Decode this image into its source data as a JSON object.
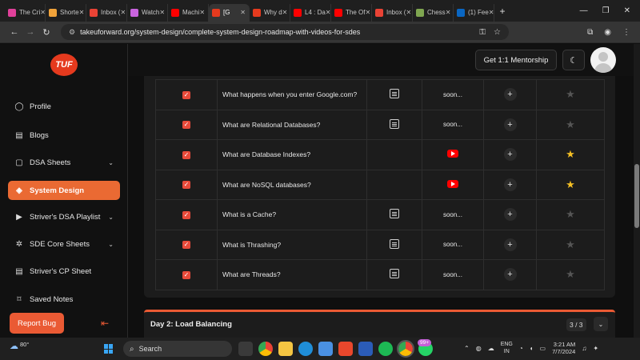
{
  "browser": {
    "tabs": [
      {
        "label": "The Cri",
        "color": "#e0409a"
      },
      {
        "label": "Shorte",
        "color": "#f1a33a"
      },
      {
        "label": "Inbox (",
        "color": "#ea4335"
      },
      {
        "label": "Watch",
        "color": "#c964de"
      },
      {
        "label": "Machi",
        "color": "#ff0000"
      },
      {
        "label": "[G",
        "color": "#e53a1e",
        "active": true
      },
      {
        "label": "Why d",
        "color": "#e53a1e"
      },
      {
        "label": "L4 : Da",
        "color": "#ff0000"
      },
      {
        "label": "The Of",
        "color": "#ff0000"
      },
      {
        "label": "Inbox (",
        "color": "#ea4335"
      },
      {
        "label": "Chess",
        "color": "#7fa650"
      },
      {
        "label": "(1) Fee",
        "color": "#0a66c2"
      }
    ],
    "new_tab": "+",
    "url": "takeuforward.org/system-design/complete-system-design-roadmap-with-videos-for-sdes"
  },
  "sidebar": {
    "logo": "TUF",
    "items": [
      {
        "label": "Profile",
        "icon": "user-icon",
        "glyph": "◯",
        "chevron": false,
        "active": false
      },
      {
        "label": "Blogs",
        "icon": "blog-icon",
        "glyph": "▤",
        "chevron": false,
        "active": false
      },
      {
        "label": "DSA Sheets",
        "icon": "clipboard-icon",
        "glyph": "▢",
        "chevron": true,
        "active": false
      },
      {
        "label": "System Design",
        "icon": "design-icon",
        "glyph": "◈",
        "chevron": false,
        "active": true
      },
      {
        "label": "Striver's DSA Playlist",
        "icon": "play-icon",
        "glyph": "▶",
        "chevron": true,
        "active": false
      },
      {
        "label": "SDE Core Sheets",
        "icon": "cog-icon",
        "glyph": "✲",
        "chevron": true,
        "active": false
      },
      {
        "label": "Striver's CP Sheet",
        "icon": "sheet-icon",
        "glyph": "▤",
        "chevron": false,
        "active": false
      },
      {
        "label": "Saved Notes",
        "icon": "bookmark-icon",
        "glyph": "⌑",
        "chevron": false,
        "active": false
      }
    ],
    "report_bug": "Report Bug"
  },
  "header": {
    "mentorship": "Get 1:1 Mentorship"
  },
  "problems": {
    "rows": [
      {
        "title": "What happens when you enter Google.com?",
        "article": true,
        "video": "soon...",
        "starred": false
      },
      {
        "title": "What are Relational Databases?",
        "article": true,
        "video": "soon...",
        "starred": false
      },
      {
        "title": "What are Database Indexes?",
        "article": false,
        "video": "youtube",
        "starred": true
      },
      {
        "title": "What are NoSQL databases?",
        "article": false,
        "video": "youtube",
        "starred": true
      },
      {
        "title": "What is a Cache?",
        "article": true,
        "video": "soon...",
        "starred": false
      },
      {
        "title": "What is Thrashing?",
        "article": true,
        "video": "soon...",
        "starred": false
      },
      {
        "title": "What are Threads?",
        "article": true,
        "video": "soon...",
        "starred": false
      }
    ]
  },
  "next_section": {
    "title": "Day 2: Load Balancing",
    "count": "3 / 3"
  },
  "taskbar": {
    "temperature": "80°",
    "search": "Search",
    "badge": "99+",
    "lang_line1": "ENG",
    "lang_line2": "IN",
    "time": "3:21 AM",
    "date": "7/7/2024"
  }
}
